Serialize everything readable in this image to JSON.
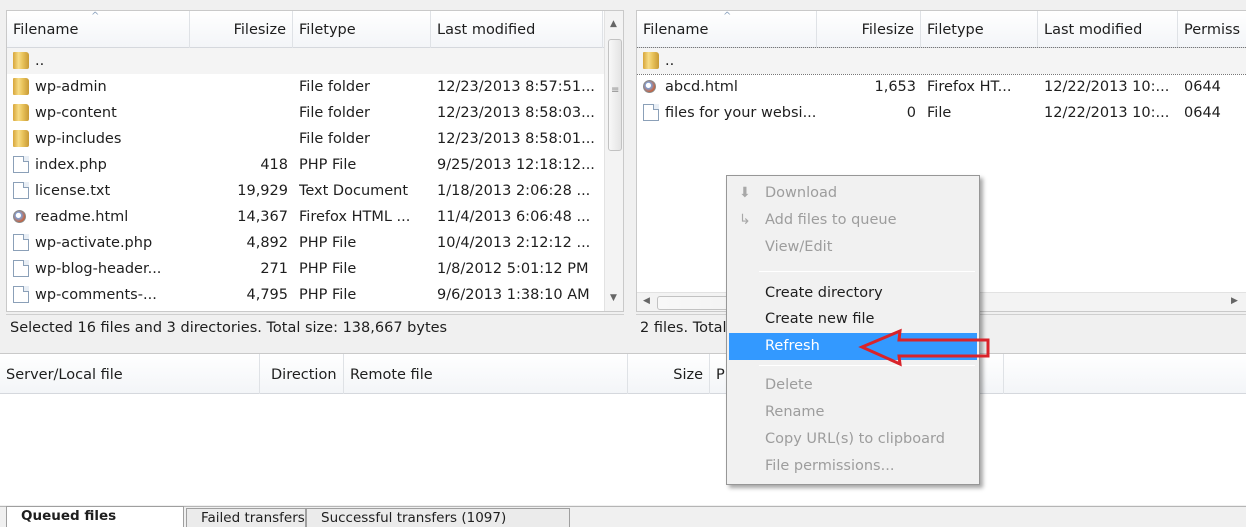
{
  "local": {
    "columns": [
      "Filename",
      "Filesize",
      "Filetype",
      "Last modified"
    ],
    "rows": [
      {
        "name": "..",
        "size": "",
        "type": "",
        "modified": "",
        "icon": "folder-icon"
      },
      {
        "name": "wp-admin",
        "size": "",
        "type": "File folder",
        "modified": "12/23/2013 8:57:51...",
        "icon": "folder-icon"
      },
      {
        "name": "wp-content",
        "size": "",
        "type": "File folder",
        "modified": "12/23/2013 8:58:03...",
        "icon": "folder-icon"
      },
      {
        "name": "wp-includes",
        "size": "",
        "type": "File folder",
        "modified": "12/23/2013 8:58:01...",
        "icon": "folder-icon"
      },
      {
        "name": "index.php",
        "size": "418",
        "type": "PHP File",
        "modified": "9/25/2013 12:18:12...",
        "icon": "document-icon"
      },
      {
        "name": "license.txt",
        "size": "19,929",
        "type": "Text Document",
        "modified": "1/18/2013 2:06:28 ...",
        "icon": "document-icon"
      },
      {
        "name": "readme.html",
        "size": "14,367",
        "type": "Firefox HTML ...",
        "modified": "11/4/2013 6:06:48 ...",
        "icon": "firefox-icon"
      },
      {
        "name": "wp-activate.php",
        "size": "4,892",
        "type": "PHP File",
        "modified": "10/4/2013 2:12:12 ...",
        "icon": "document-icon"
      },
      {
        "name": "wp-blog-header...",
        "size": "271",
        "type": "PHP File",
        "modified": "1/8/2012 5:01:12 PM",
        "icon": "document-icon"
      },
      {
        "name": "wp-comments-...",
        "size": "4,795",
        "type": "PHP File",
        "modified": "9/6/2013 1:38:10 AM",
        "icon": "document-icon"
      }
    ],
    "status": "Selected 16 files and 3 directories. Total size: 138,667 bytes"
  },
  "remote": {
    "columns": [
      "Filename",
      "Filesize",
      "Filetype",
      "Last modified",
      "Permiss"
    ],
    "rows": [
      {
        "name": "..",
        "size": "",
        "type": "",
        "modified": "",
        "perms": "",
        "icon": "folder-icon"
      },
      {
        "name": "abcd.html",
        "size": "1,653",
        "type": "Firefox HT...",
        "modified": "12/22/2013 10:...",
        "perms": "0644",
        "icon": "firefox-icon"
      },
      {
        "name": "files for your websi...",
        "size": "0",
        "type": "File",
        "modified": "12/22/2013 10:...",
        "perms": "0644",
        "icon": "document-icon"
      }
    ],
    "status": "2 files. Total"
  },
  "queue": {
    "columns": [
      "Server/Local file",
      "Direction",
      "Remote file",
      "Size",
      "P"
    ]
  },
  "context_menu": {
    "items": [
      {
        "label": "Download",
        "disabled": true,
        "icon": "download-icon"
      },
      {
        "label": "Add files to queue",
        "disabled": true,
        "icon": "add-to-queue-icon"
      },
      {
        "label": "View/Edit",
        "disabled": true
      },
      {
        "label": "Create directory",
        "disabled": false
      },
      {
        "label": "Create new file",
        "disabled": false
      },
      {
        "label": "Refresh",
        "disabled": false,
        "highlighted": true
      },
      {
        "label": "Delete",
        "disabled": true
      },
      {
        "label": "Rename",
        "disabled": true
      },
      {
        "label": "Copy URL(s) to clipboard",
        "disabled": true
      },
      {
        "label": "File permissions...",
        "disabled": true
      }
    ]
  },
  "tabs": [
    "Queued files",
    "Failed transfers",
    "Successful transfers (1097)"
  ],
  "colors": {
    "highlight": "#3399ff",
    "annotation_arrow": "#d9232a"
  }
}
